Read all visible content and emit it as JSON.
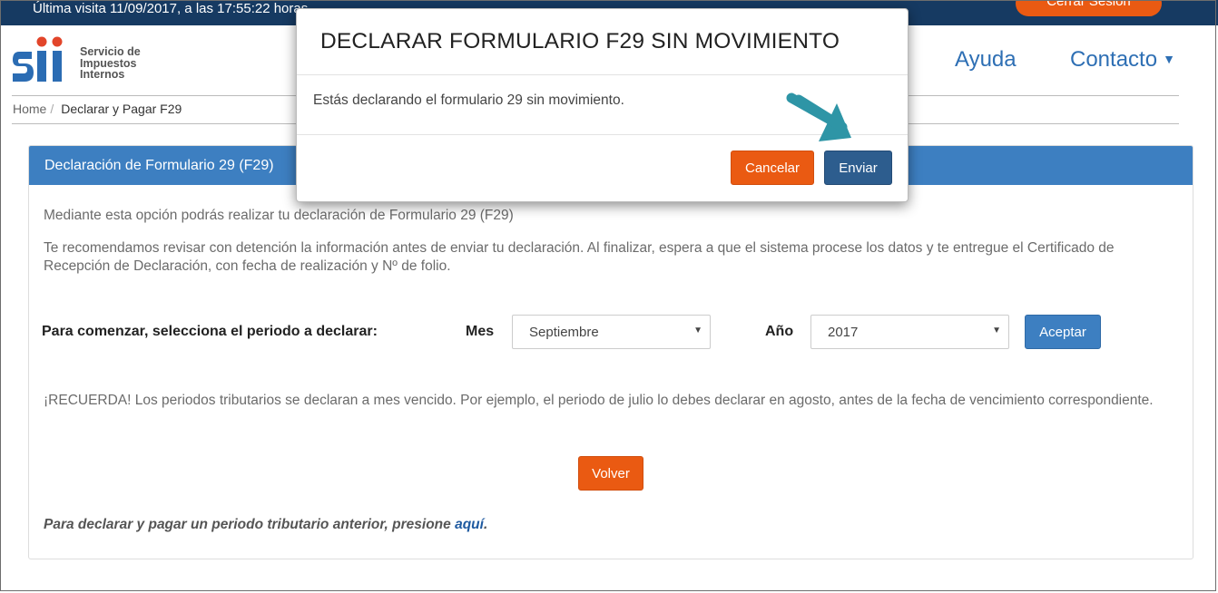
{
  "topbar": {
    "last_visit": "Última visita 11/09/2017, a las 17:55:22 horas",
    "logout_label": "Cerrar Sesión"
  },
  "header": {
    "logo_text": [
      "Servicio de",
      "Impuestos",
      "Internos"
    ],
    "nav": {
      "ayuda": "Ayuda",
      "contacto": "Contacto"
    }
  },
  "breadcrumb": {
    "home": "Home",
    "separator": "/",
    "current": "Declarar y Pagar F29"
  },
  "panel": {
    "title": "Declaración de Formulario 29 (F29)",
    "intro": "Mediante esta opción podrás realizar tu declaración de Formulario 29 (F29)",
    "recommend": "Te recomendamos revisar con detención la información antes de enviar tu declaración. Al finalizar, espera a que el sistema procese los datos y te entregue el Certificado de Recepción de Declaración, con fecha de realización y Nº de folio.",
    "period_label": "Para comenzar, selecciona el periodo a declarar:",
    "mes_label": "Mes",
    "mes_value": "Septiembre",
    "anio_label": "Año",
    "anio_value": "2017",
    "accept_label": "Aceptar",
    "reminder": "¡RECUERDA! Los periodos tributarios se declaran a mes vencido. Por ejemplo, el periodo de julio lo debes declarar en agosto, antes de la fecha de vencimiento correspondiente.",
    "back_label": "Volver",
    "previous_text": "Para declarar y pagar un periodo tributario anterior, presione",
    "previous_link": "aquí",
    "previous_end": "."
  },
  "modal": {
    "title": "DECLARAR FORMULARIO F29 SIN MOVIMIENTO",
    "body": "Estás declarando el formulario 29 sin movimiento.",
    "cancel_label": "Cancelar",
    "send_label": "Enviar"
  },
  "colors": {
    "topbar": "#163a62",
    "accent_orange": "#ea5a12",
    "panel_blue": "#3d7fc1",
    "send_blue": "#2d5d8e",
    "arrow_teal": "#2e95a6",
    "link_blue": "#2e6fb4"
  },
  "icons": [
    "sii-logo",
    "chevron-down-icon",
    "select-arrow-icon",
    "pointer-arrow-icon"
  ]
}
